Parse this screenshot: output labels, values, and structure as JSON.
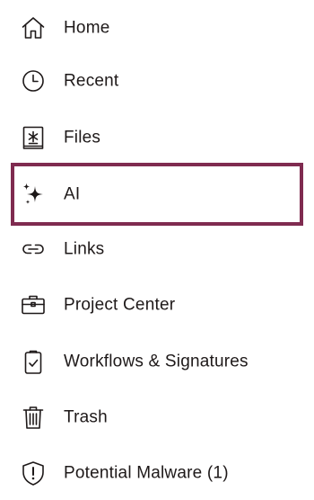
{
  "sidebar": {
    "items": [
      {
        "label": "Home",
        "icon": "home-icon"
      },
      {
        "label": "Recent",
        "icon": "clock-icon"
      },
      {
        "label": "Files",
        "icon": "files-icon"
      },
      {
        "label": "AI",
        "icon": "sparkle-icon",
        "selected": true
      },
      {
        "label": "Links",
        "icon": "link-icon"
      },
      {
        "label": "Project Center",
        "icon": "briefcase-icon"
      },
      {
        "label": "Workflows & Signatures",
        "icon": "clipboard-check-icon"
      },
      {
        "label": "Trash",
        "icon": "trash-icon"
      },
      {
        "label": "Potential Malware (1)",
        "icon": "shield-alert-icon"
      }
    ],
    "selected_border_color": "#7f2b50",
    "text_color": "#1e1919"
  }
}
